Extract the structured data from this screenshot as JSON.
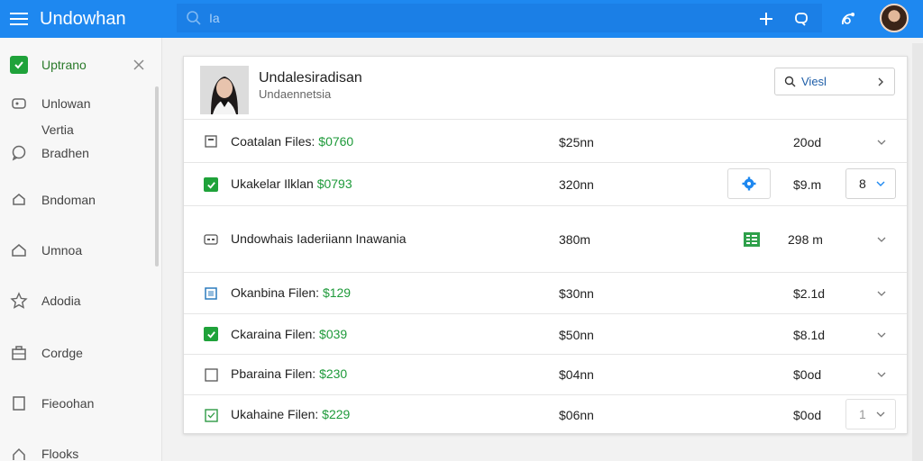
{
  "app": {
    "title": "Undowhan"
  },
  "search": {
    "placeholder": "Ia"
  },
  "sidebar": {
    "items": [
      {
        "label": "Uptrano",
        "icon": "check-square-icon"
      },
      {
        "label": "Unlowan",
        "icon": "tag-icon"
      },
      {
        "label": "Vertia",
        "icon": ""
      },
      {
        "label": "Bradhen",
        "icon": "chat-bubble-icon"
      },
      {
        "label": "Bndoman",
        "icon": "rocket-icon"
      },
      {
        "label": "Umnoa",
        "icon": "home-icon"
      },
      {
        "label": "Adodia",
        "icon": "star-icon"
      },
      {
        "label": "Cordge",
        "icon": "briefcase-icon"
      },
      {
        "label": "Fieoohan",
        "icon": "document-icon"
      },
      {
        "label": "Flooks",
        "icon": "upload-icon"
      }
    ]
  },
  "profile": {
    "name": "Undalesiradisan",
    "subtitle": "Undaennetsia",
    "view_label": "Viesl"
  },
  "rows": [
    {
      "label": "Coatalan Files: ",
      "amount": "$0760",
      "size": "$25nn",
      "time": "20od",
      "icon": "checkbox-empty-icon"
    },
    {
      "label": "Ukakelar Ilklan ",
      "amount": "$0793",
      "size": "320nn",
      "time": "$9.m",
      "icon": "checkbox-checked-icon",
      "select_value": "8"
    },
    {
      "label": "Undowhais Iaderiiann Inawania",
      "amount": "",
      "size": "380m",
      "time": "298 m",
      "icon": "card-icon"
    },
    {
      "label": "Okanbina Filen: ",
      "amount": "$129",
      "size": "$30nn",
      "time": "$2.1d",
      "icon": "image-icon"
    },
    {
      "label": "Ckaraina Filen: ",
      "amount": "$039",
      "size": "$50nn",
      "time": "$8.1d",
      "icon": "checkbox-checked-icon"
    },
    {
      "label": "Pbaraina Filen: ",
      "amount": "$230",
      "size": "$04nn",
      "time": "$0od",
      "icon": "checkbox-empty-icon"
    },
    {
      "label": "Ukahaine Filen: ",
      "amount": "$229",
      "size": "$06nn",
      "time": "$0od",
      "icon": "checkbox-outline-green-icon",
      "select_value": "1"
    }
  ],
  "colors": {
    "accent": "#1e88f0",
    "amount": "#1e9a3a",
    "checkbox": "#1fa23a",
    "gear": "#1e88f0"
  }
}
